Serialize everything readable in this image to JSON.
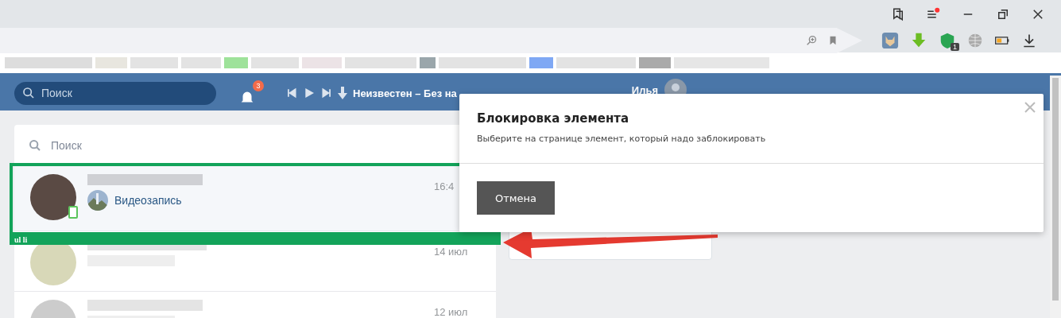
{
  "browser": {
    "extension_badge": "1"
  },
  "header": {
    "search_placeholder": "Поиск",
    "notifications_badge": "3",
    "player_track": "Неизвестен – Без на",
    "user_name": "Илья"
  },
  "messages": {
    "search_placeholder": "Поиск",
    "dialogs": [
      {
        "time": "16:4",
        "attachment": "Видеозапись",
        "selected": true,
        "online": true
      },
      {
        "time": "14 июл",
        "selected": false,
        "online": false
      },
      {
        "time": "12 июл",
        "selected": false,
        "online": false
      }
    ]
  },
  "highlight": {
    "label": "ul li"
  },
  "modal": {
    "title": "Блокировка элемента",
    "text": "Выберите на странице элемент, который надо заблокировать",
    "cancel_button": "Отмена"
  }
}
